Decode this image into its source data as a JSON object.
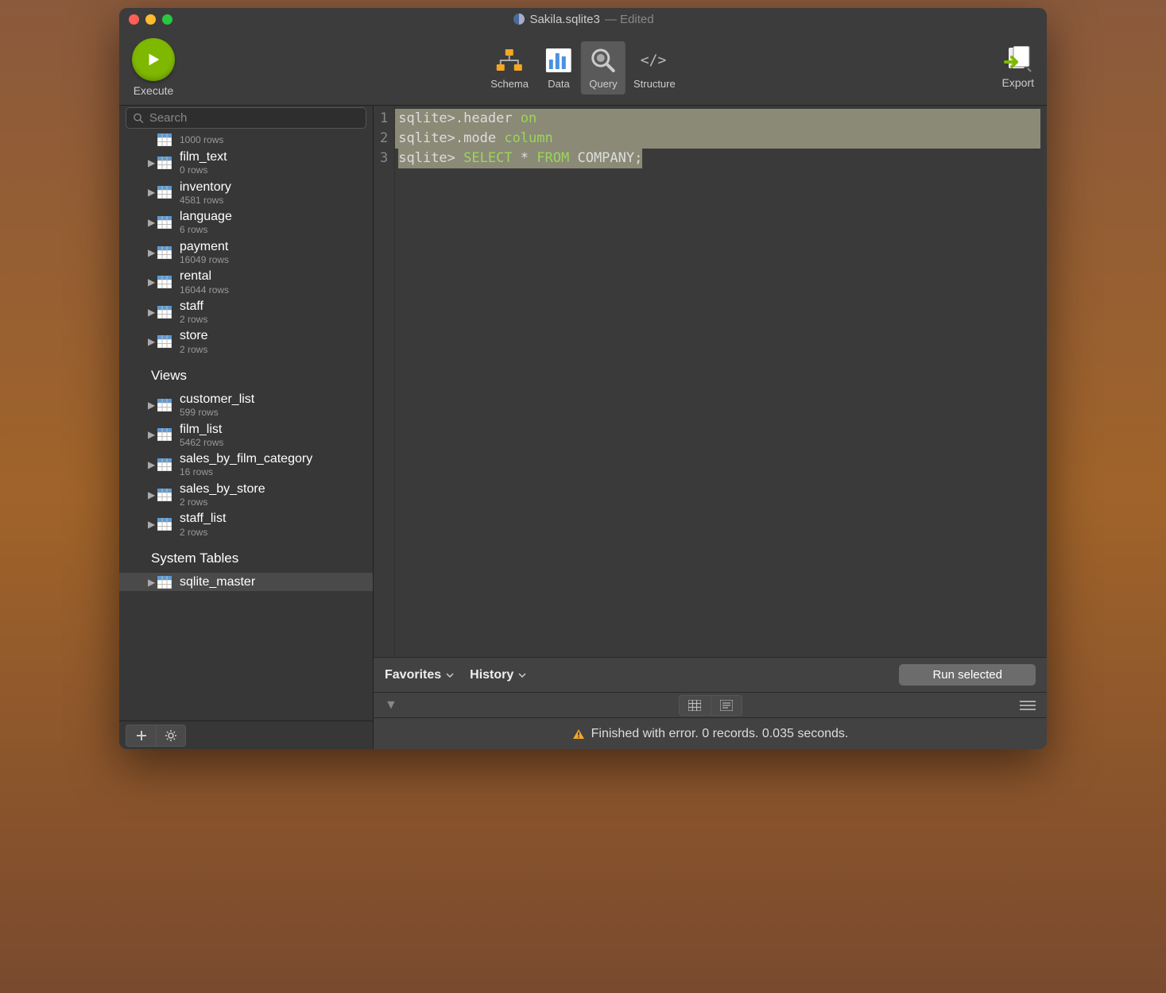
{
  "title": {
    "filename": "Sakila.sqlite3",
    "suffix": "— Edited"
  },
  "toolbar": {
    "execute": "Execute",
    "schema": "Schema",
    "data": "Data",
    "query": "Query",
    "structure": "Structure",
    "export": "Export"
  },
  "search": {
    "placeholder": "Search"
  },
  "sidebar": {
    "partial_first_meta": "1000 rows",
    "tables": [
      {
        "name": "film_text",
        "meta": "0 rows"
      },
      {
        "name": "inventory",
        "meta": "4581 rows"
      },
      {
        "name": "language",
        "meta": "6 rows"
      },
      {
        "name": "payment",
        "meta": "16049 rows"
      },
      {
        "name": "rental",
        "meta": "16044 rows"
      },
      {
        "name": "staff",
        "meta": "2 rows"
      },
      {
        "name": "store",
        "meta": "2 rows"
      }
    ],
    "views_header": "Views",
    "views": [
      {
        "name": "customer_list",
        "meta": "599 rows"
      },
      {
        "name": "film_list",
        "meta": "5462 rows"
      },
      {
        "name": "sales_by_film_category",
        "meta": "16 rows"
      },
      {
        "name": "sales_by_store",
        "meta": "2 rows"
      },
      {
        "name": "staff_list",
        "meta": "2 rows"
      }
    ],
    "system_header": "System Tables",
    "system": [
      {
        "name": "sqlite_master",
        "meta": ""
      }
    ]
  },
  "editor": {
    "lines": [
      {
        "n": "1",
        "segments": [
          {
            "t": "sqlite>",
            "c": "tok-prompt"
          },
          {
            "t": ".header ",
            "c": "tok-cmd"
          },
          {
            "t": "on",
            "c": "tok-kw"
          }
        ],
        "hl": true
      },
      {
        "n": "2",
        "segments": [
          {
            "t": "sqlite>",
            "c": "tok-prompt"
          },
          {
            "t": ".mode ",
            "c": "tok-cmd"
          },
          {
            "t": "column",
            "c": "tok-kw"
          }
        ],
        "hl": true
      },
      {
        "n": "3",
        "segments": [
          {
            "t": "sqlite> ",
            "c": "tok-prompt"
          },
          {
            "t": "SELECT",
            "c": "tok-kw"
          },
          {
            "t": " * ",
            "c": "tok-plain"
          },
          {
            "t": "FROM",
            "c": "tok-kw"
          },
          {
            "t": " COMPANY;",
            "c": "tok-plain"
          }
        ],
        "hl": false,
        "partial_hl": true
      }
    ]
  },
  "editor_toolbar": {
    "favorites": "Favorites",
    "history": "History",
    "run": "Run selected"
  },
  "status": "Finished with error. 0 records. 0.035 seconds."
}
